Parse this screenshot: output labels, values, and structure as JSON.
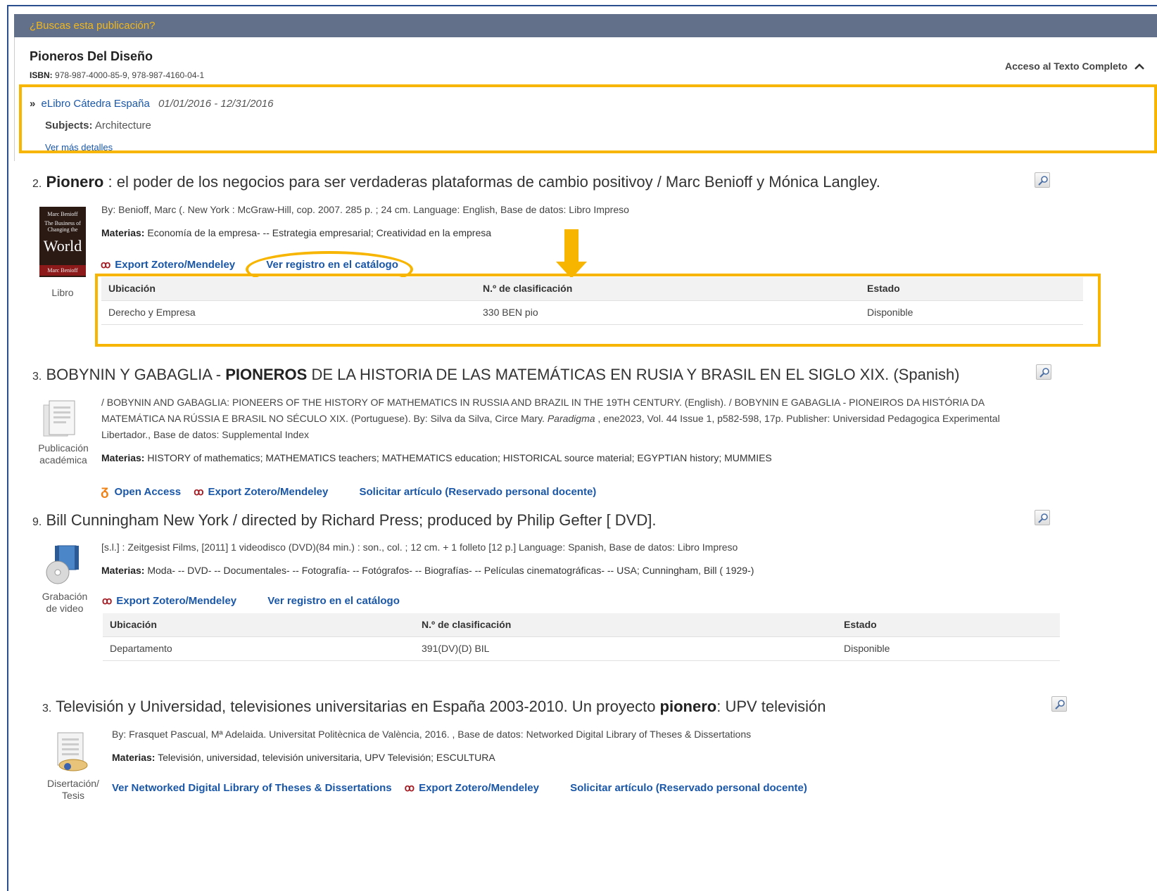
{
  "banner": {
    "text": "¿Buscas esta publicación?"
  },
  "publication": {
    "title": "Pioneros Del Diseño",
    "isbn_label": "ISBN:",
    "isbn_value": "978-987-4000-85-9, 978-987-4160-04-1",
    "access_label": "Acceso al Texto Completo",
    "provider_link": "eLibro Cátedra España",
    "provider_dates": "01/01/2016 - 12/31/2016",
    "subjects_label": "Subjects:",
    "subjects_value": "Architecture",
    "more_details": "Ver más detalles"
  },
  "results": [
    {
      "number": "2.",
      "title_bold": "Pionero",
      "title_rest": " : el poder de los negocios para ser verdaderas plataformas de cambio positivoy / Marc Benioff y Mónica Langley.",
      "meta": "By: Benioff, Marc (. New York : McGraw-Hill, cop. 2007. 285 p. ; 24 cm. Language: English, Base de datos: Libro Impreso",
      "materias_label": "Materias:",
      "materias": "Economía de la empresa- -- Estrategia empresarial; Creatividad en la empresa",
      "type": "Libro",
      "cover": {
        "author": "Marc Benioff",
        "line1": "The Business of",
        "line2": "Changing the",
        "word": "World"
      },
      "actions": {
        "export": "Export Zotero/Mendeley",
        "catalog": "Ver registro en el catálogo"
      },
      "holdings": {
        "headers": [
          "Ubicación",
          "N.º de clasificación",
          "Estado"
        ],
        "rows": [
          [
            "Derecho y Empresa",
            "330 BEN pio",
            "Disponible"
          ]
        ]
      }
    },
    {
      "number": "3.",
      "title_pre": "BOBYNIN Y GABAGLIA - ",
      "title_bold": "PIONEROS",
      "title_rest": " DE LA HISTORIA DE LAS MATEMÁTICAS EN RUSIA Y BRASIL EN EL SIGLO XIX. (Spanish)",
      "meta_1": "/ BOBYNIN AND GABAGLIA: PIONEERS OF THE HISTORY OF MATHEMATICS IN RUSSIA AND BRAZIL IN THE 19TH CENTURY. (English). / BOBYNIN E GABAGLIA - PIONEIROS DA HISTÓRIA DA",
      "meta_2a": "MATEMÁTICA NA RÚSSIA E BRASIL NO SÉCULO XIX. (Portuguese). By: Silva da Silva, Circe Mary. ",
      "meta_2i": "Paradigma",
      "meta_2b": " , ene2023, Vol. 44 Issue 1, p582-598, 17p. Publisher: Universidad Pedagogica Experimental",
      "meta_3": "Libertador., Base de datos: Supplemental Index",
      "materias_label": "Materias:",
      "materias": "HISTORY of mathematics; MATHEMATICS teachers; MATHEMATICS education; HISTORICAL source material; EGYPTIAN history; MUMMIES",
      "type_1": "Publicación",
      "type_2": "académica",
      "actions": {
        "open_access": "Open Access",
        "export": "Export Zotero/Mendeley",
        "request": "Solicitar artículo (Reservado personal docente)"
      }
    },
    {
      "number": "9.",
      "title_rest": "Bill Cunningham New York / directed by Richard Press; produced by Philip Gefter [ DVD].",
      "meta": "[s.l.] : Zeitgesist Films, [2011] 1 videodisco (DVD)(84 min.) : son., col. ; 12 cm. + 1 folleto [12 p.] Language: Spanish, Base de datos: Libro Impreso",
      "materias_label": "Materias:",
      "materias": "Moda- -- DVD- -- Documentales- -- Fotografía- -- Fotógrafos- -- Biografías- -- Películas cinematográficas- -- USA; Cunningham, Bill ( 1929-)",
      "type_1": "Grabación",
      "type_2": "de video",
      "actions": {
        "export": "Export Zotero/Mendeley",
        "catalog": "Ver registro en el catálogo"
      },
      "holdings": {
        "headers": [
          "Ubicación",
          "N.º de clasificación",
          "Estado"
        ],
        "rows": [
          [
            "Departamento",
            "391(DV)(D) BIL",
            "Disponible"
          ]
        ]
      }
    },
    {
      "number": "3.",
      "title_pre": "Televisión y Universidad, televisiones universitarias en España 2003-2010. Un proyecto ",
      "title_bold": "pionero",
      "title_rest": ": UPV televisión",
      "meta": "By: Frasquet Pascual, Mª Adelaida. Universitat Politècnica de València, 2016. , Base de datos: Networked Digital Library of Theses & Dissertations",
      "materias_label": "Materias:",
      "materias": "Televisión, universidad, televisión universitaria, UPV Televisión; ESCULTURA",
      "type_1": "Disertación/",
      "type_2": "Tesis",
      "actions": {
        "ndltd": "Ver Networked Digital Library of Theses & Dissertations",
        "export": "Export Zotero/Mendeley",
        "request": "Solicitar artículo (Reservado personal docente)"
      }
    }
  ],
  "icons": [
    "double-chevron-icon",
    "chevron-up-icon",
    "zoom-icon",
    "mendeley-icon",
    "open-access-icon",
    "document-icon",
    "video-icon",
    "thesis-icon",
    "book-cover"
  ],
  "colors": {
    "banner_bg": "#627089",
    "banner_text": "#f3b81b",
    "highlight": "#f7b500",
    "link": "#1a57a8",
    "mendeley": "#a31b23",
    "open_access": "#f07f10"
  }
}
